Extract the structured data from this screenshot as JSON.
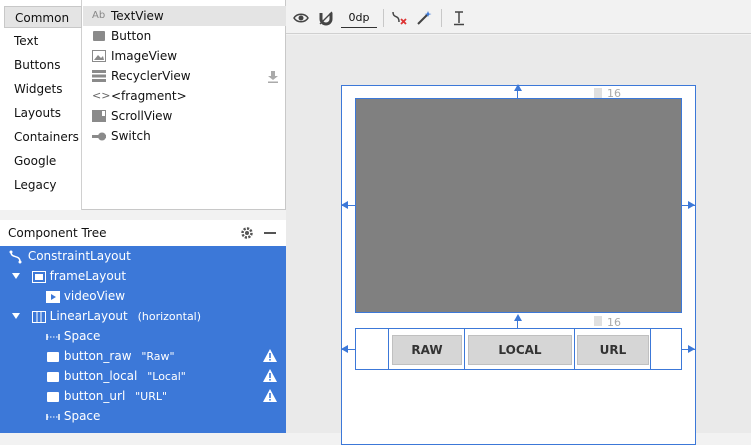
{
  "palette": {
    "categories": [
      "Common",
      "Text",
      "Buttons",
      "Widgets",
      "Layouts",
      "Containers",
      "Google",
      "Legacy"
    ],
    "selected_category": "Common",
    "items": [
      {
        "label": "TextView",
        "icon": "textview-icon",
        "glyph": "Ab"
      },
      {
        "label": "Button",
        "icon": "button-icon"
      },
      {
        "label": "ImageView",
        "icon": "imageview-icon"
      },
      {
        "label": "RecyclerView",
        "icon": "recyclerview-icon"
      },
      {
        "label": "<fragment>",
        "icon": "fragment-icon",
        "glyph": "<>"
      },
      {
        "label": "ScrollView",
        "icon": "scrollview-icon"
      },
      {
        "label": "Switch",
        "icon": "switch-icon"
      }
    ],
    "selected_item": "TextView"
  },
  "component_tree": {
    "title": "Component Tree",
    "nodes": [
      {
        "label": "ConstraintLayout",
        "depth": 0,
        "icon": "constraint-layout-icon"
      },
      {
        "label": "frameLayout",
        "depth": 1,
        "icon": "frame-layout-icon",
        "expanded": true
      },
      {
        "label": "videoView",
        "depth": 2,
        "icon": "video-view-icon"
      },
      {
        "label": "LinearLayout",
        "depth": 1,
        "icon": "linear-layout-icon",
        "expanded": true,
        "attr": "(horizontal)"
      },
      {
        "label": "Space",
        "depth": 2,
        "icon": "space-icon"
      },
      {
        "label": "button_raw",
        "depth": 2,
        "icon": "button-icon",
        "attr": "\"Raw\"",
        "warning": true
      },
      {
        "label": "button_local",
        "depth": 2,
        "icon": "button-icon",
        "attr": "\"Local\"",
        "warning": true
      },
      {
        "label": "button_url",
        "depth": 2,
        "icon": "button-icon",
        "attr": "\"URL\"",
        "warning": true
      },
      {
        "label": "Space",
        "depth": 2,
        "icon": "space-icon"
      }
    ]
  },
  "toolbar": {
    "margin_value": "0dp",
    "icons": [
      "eye-icon",
      "magnet-icon",
      "margin-field",
      "clear-constraints-icon",
      "infer-constraints-icon",
      "guideline-icon"
    ]
  },
  "design": {
    "buttons": [
      "RAW",
      "LOCAL",
      "URL"
    ],
    "margin_top_label": "16",
    "margin_bottom_label": "16"
  },
  "colors": {
    "selection_blue": "#3c78d8",
    "video_gray": "#808080",
    "warning": "#ffffff"
  }
}
